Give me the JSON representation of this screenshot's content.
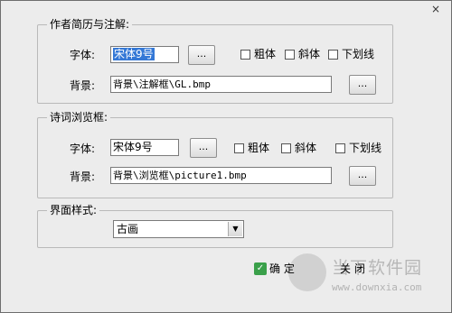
{
  "window": {
    "close_label": "×"
  },
  "author": {
    "title": "作者简历与注解:",
    "font_label": "字体:",
    "font_value": "宋体9号",
    "browse": "...",
    "bold": "粗体",
    "italic": "斜体",
    "underline": "下划线",
    "bg_label": "背景:",
    "bg_value": "背景\\注解框\\GL.bmp",
    "bg_browse": "..."
  },
  "poem": {
    "title": "诗词浏览框:",
    "font_label": "字体:",
    "font_value": "宋体9号",
    "browse": "...",
    "bold": "粗体",
    "italic": "斜体",
    "underline": "下划线",
    "bg_label": "背景:",
    "bg_value": "背景\\浏览框\\picture1.bmp",
    "bg_browse": "..."
  },
  "style": {
    "title": "界面样式:",
    "selected": "古画"
  },
  "actions": {
    "ok": "确 定",
    "close": "关 闭"
  },
  "watermark": {
    "text": "当下软件园",
    "url": "www.downxia.com"
  }
}
